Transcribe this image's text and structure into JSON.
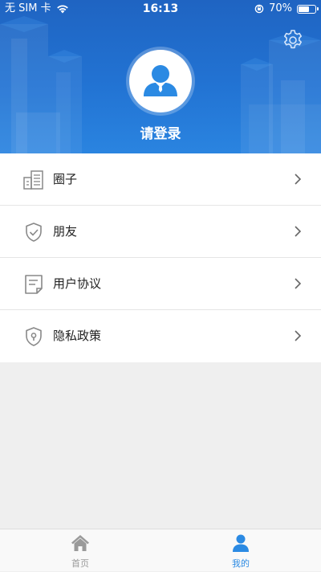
{
  "status_bar": {
    "carrier": "无 SIM 卡",
    "time": "16:13",
    "battery": "70%",
    "battery_level": 0.7
  },
  "header": {
    "login_text": "请登录",
    "icons": {
      "settings": "gear-icon",
      "avatar": "user-avatar-icon"
    }
  },
  "menu": {
    "items": [
      {
        "label": "圈子",
        "icon": "building-icon"
      },
      {
        "label": "朋友",
        "icon": "shield-check-icon"
      },
      {
        "label": "用户协议",
        "icon": "document-icon"
      },
      {
        "label": "隐私政策",
        "icon": "shield-lock-icon"
      }
    ]
  },
  "tabbar": {
    "tabs": [
      {
        "label": "首页",
        "icon": "home-icon",
        "active": false
      },
      {
        "label": "我的",
        "icon": "user-icon",
        "active": true
      }
    ]
  },
  "colors": {
    "header_bg": "#1f64c2",
    "accent": "#2b8ae3",
    "tab_inactive": "#9a9a9a",
    "menu_icon": "#888888",
    "background": "#efefef"
  }
}
